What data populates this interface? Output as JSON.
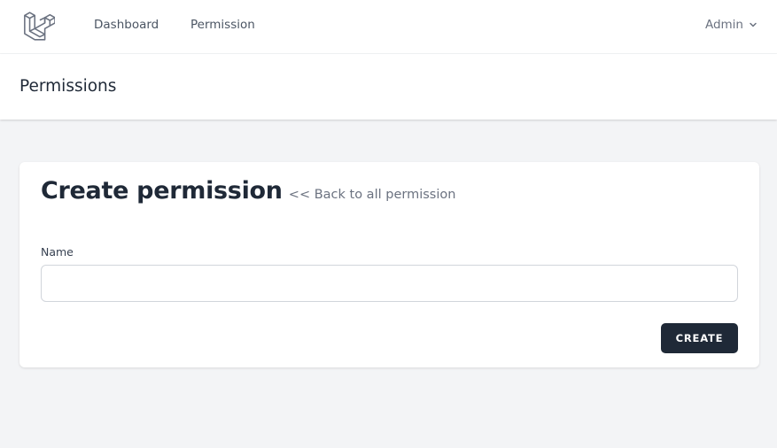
{
  "nav": {
    "logo_icon": "laravel-logo-icon",
    "links": [
      {
        "label": "Dashboard"
      },
      {
        "label": "Permission"
      }
    ],
    "user": {
      "name": "Admin",
      "icon": "chevron-down-icon"
    }
  },
  "header": {
    "title": "Permissions"
  },
  "form": {
    "heading": "Create permission",
    "back_link": "<< Back to all permission",
    "name_label": "Name",
    "name_value": "",
    "name_placeholder": "",
    "submit_label": "CREATE"
  },
  "colors": {
    "page_background": "#f3f4f6",
    "surface": "#ffffff",
    "button": "#1f2937",
    "muted_text": "#6b7280"
  }
}
